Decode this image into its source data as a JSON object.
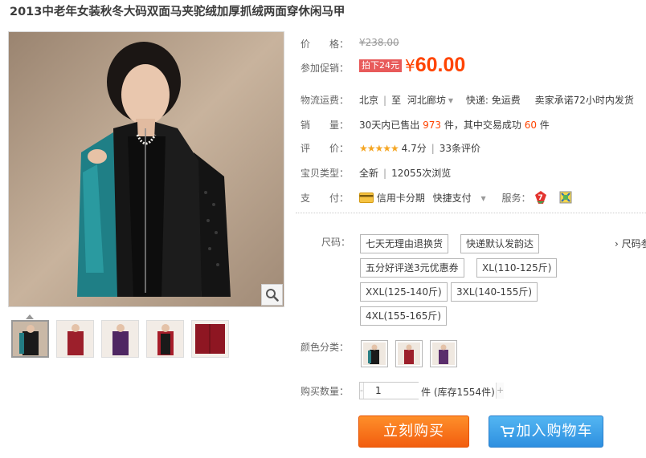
{
  "product": {
    "title": "2013中老年女装秋冬大码双面马夹驼绒加厚抓绒两面穿休闲马甲"
  },
  "price": {
    "label": "价　　格：",
    "original": "¥238.00",
    "promo_label": "参加促销：",
    "promo_tag": "拍下24元",
    "yen": "¥",
    "value": "60.00"
  },
  "shipping": {
    "label": "物流运费：",
    "from": "北京",
    "sep": "|",
    "to_prefix": "至",
    "to": "河北廊坊",
    "express": "快递: 免运费",
    "promise": "卖家承诺72小时内发货"
  },
  "sales": {
    "label": "销　　量：",
    "prefix": "30天内已售出",
    "sold": "973",
    "middle": "件，其中交易成功",
    "success": "60",
    "suffix": "件"
  },
  "rating": {
    "label": "评　　价：",
    "stars": "★★★★★",
    "score": "4.7分",
    "sep": "|",
    "reviews": "33条评价"
  },
  "type": {
    "label": "宝贝类型：",
    "value": "全新",
    "sep": "|",
    "views": "12055次浏览"
  },
  "payment": {
    "label": "支　　付：",
    "credit": "信用卡分期",
    "quick": "快捷支付",
    "service_label": "服务："
  },
  "size": {
    "label": "尺码：",
    "options": [
      "七天无理由退换货",
      "快递默认发韵达",
      "五分好评送3元优惠券",
      "XL(110-125斤)",
      "XXL(125-140斤)",
      "3XL(140-155斤)",
      "4XL(155-165斤)"
    ],
    "chart_link": "› 尺码参照表"
  },
  "color": {
    "label": "颜色分类：",
    "swatches": [
      {
        "name": "teal",
        "color": "#2a7f85"
      },
      {
        "name": "red",
        "color": "#9c1f2b"
      },
      {
        "name": "purple",
        "color": "#5a2d6b"
      }
    ]
  },
  "quantity": {
    "label": "购买数量：",
    "minus": "-",
    "value": "1",
    "plus": "+",
    "unit": "件",
    "stock": "(库存1554件)"
  },
  "actions": {
    "buy": "立刻购买",
    "cart": "加入购物车"
  },
  "colors": {
    "price_orange": "#ff4400",
    "buy_orange": "#f25d0f",
    "cart_blue": "#2e8fe0"
  },
  "icons": {
    "zoom": "magnifier-icon",
    "card": "credit-card-icon",
    "cart": "shopping-cart-icon"
  }
}
